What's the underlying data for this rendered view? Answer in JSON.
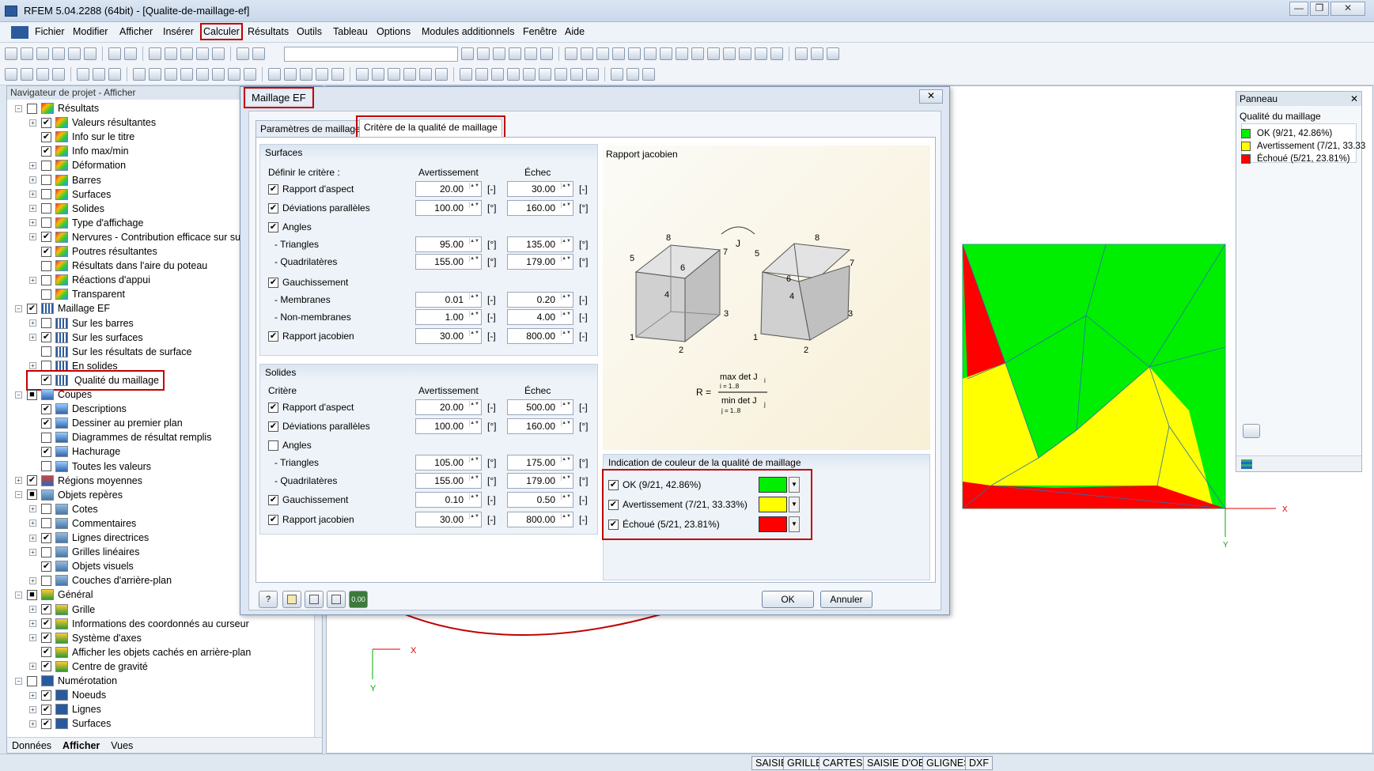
{
  "window": {
    "title": "RFEM 5.04.2288 (64bit) - [Qualite-de-maillage-ef]",
    "minimize": "—",
    "maximize": "❐",
    "close": "✕"
  },
  "menu": [
    "Fichier",
    "Modifier",
    "Afficher",
    "Insérer",
    "Calculer",
    "Résultats",
    "Outils",
    "Tableau",
    "Options",
    "Modules additionnels",
    "Fenêtre",
    "Aide"
  ],
  "navigator": {
    "header": "Navigateur de projet - Afficher",
    "items": [
      {
        "label": "Résultats",
        "level": 0,
        "expander": "−",
        "checked": "",
        "icon": "results-icon"
      },
      {
        "label": "Valeurs résultantes",
        "level": 1,
        "expander": "+",
        "checked": "✔",
        "icon": "results-icon"
      },
      {
        "label": "Info sur le titre",
        "level": 1,
        "expander": "",
        "checked": "✔",
        "icon": "results-icon"
      },
      {
        "label": "Info max/min",
        "level": 1,
        "expander": "",
        "checked": "✔",
        "icon": "results-icon"
      },
      {
        "label": "Déformation",
        "level": 1,
        "expander": "+",
        "checked": "",
        "icon": "results-icon"
      },
      {
        "label": "Barres",
        "level": 1,
        "expander": "+",
        "checked": "",
        "icon": "results-icon"
      },
      {
        "label": "Surfaces",
        "level": 1,
        "expander": "+",
        "checked": "",
        "icon": "results-icon"
      },
      {
        "label": "Solides",
        "level": 1,
        "expander": "+",
        "checked": "",
        "icon": "results-icon"
      },
      {
        "label": "Type d'affichage",
        "level": 1,
        "expander": "+",
        "checked": "",
        "icon": "results-icon"
      },
      {
        "label": "Nervures - Contribution efficace sur surf",
        "level": 1,
        "expander": "+",
        "checked": "✔",
        "icon": "results-icon"
      },
      {
        "label": "Poutres résultantes",
        "level": 1,
        "expander": "",
        "checked": "✔",
        "icon": "results-icon"
      },
      {
        "label": "Résultats dans l'aire du poteau",
        "level": 1,
        "expander": "",
        "checked": "",
        "icon": "results-icon"
      },
      {
        "label": "Réactions d'appui",
        "level": 1,
        "expander": "+",
        "checked": "",
        "icon": "results-icon"
      },
      {
        "label": "Transparent",
        "level": 1,
        "expander": "",
        "checked": "",
        "icon": "results-icon"
      },
      {
        "label": "Maillage EF",
        "level": 0,
        "expander": "−",
        "checked": "✔",
        "icon": "mesh-icon"
      },
      {
        "label": "Sur les barres",
        "level": 1,
        "expander": "+",
        "checked": "",
        "icon": "mesh-icon"
      },
      {
        "label": "Sur les surfaces",
        "level": 1,
        "expander": "+",
        "checked": "✔",
        "icon": "mesh-icon"
      },
      {
        "label": "Sur les résultats de surface",
        "level": 1,
        "expander": "",
        "checked": "",
        "icon": "mesh-icon"
      },
      {
        "label": "En solides",
        "level": 1,
        "expander": "+",
        "checked": "",
        "icon": "mesh-icon"
      },
      {
        "label": "Qualité du maillage",
        "level": 1,
        "expander": "",
        "checked": "✔",
        "icon": "mesh-icon"
      },
      {
        "label": "Coupes",
        "level": 0,
        "expander": "−",
        "checked": "■",
        "icon": "section-icon"
      },
      {
        "label": "Descriptions",
        "level": 1,
        "expander": "",
        "checked": "✔",
        "icon": "section-icon"
      },
      {
        "label": "Dessiner au premier plan",
        "level": 1,
        "expander": "",
        "checked": "✔",
        "icon": "section-icon"
      },
      {
        "label": "Diagrammes de résultat remplis",
        "level": 1,
        "expander": "",
        "checked": "",
        "icon": "section-icon"
      },
      {
        "label": "Hachurage",
        "level": 1,
        "expander": "",
        "checked": "✔",
        "icon": "section-icon"
      },
      {
        "label": "Toutes les valeurs",
        "level": 1,
        "expander": "",
        "checked": "",
        "icon": "section-icon"
      },
      {
        "label": "Régions moyennes",
        "level": 0,
        "expander": "+",
        "checked": "✔",
        "icon": "region-icon"
      },
      {
        "label": "Objets repères",
        "level": 0,
        "expander": "−",
        "checked": "■",
        "icon": "guide-icon"
      },
      {
        "label": "Cotes",
        "level": 1,
        "expander": "+",
        "checked": "",
        "icon": "guide-icon"
      },
      {
        "label": "Commentaires",
        "level": 1,
        "expander": "+",
        "checked": "",
        "icon": "guide-icon"
      },
      {
        "label": "Lignes directrices",
        "level": 1,
        "expander": "+",
        "checked": "✔",
        "icon": "guide-icon"
      },
      {
        "label": "Grilles linéaires",
        "level": 1,
        "expander": "+",
        "checked": "",
        "icon": "guide-icon"
      },
      {
        "label": "Objets visuels",
        "level": 1,
        "expander": "",
        "checked": "✔",
        "icon": "guide-icon"
      },
      {
        "label": "Couches d'arrière-plan",
        "level": 1,
        "expander": "+",
        "checked": "",
        "icon": "guide-icon"
      },
      {
        "label": "Général",
        "level": 0,
        "expander": "−",
        "checked": "■",
        "icon": "general-icon"
      },
      {
        "label": "Grille",
        "level": 1,
        "expander": "+",
        "checked": "✔",
        "icon": "general-icon"
      },
      {
        "label": "Informations des coordonnés au curseur",
        "level": 1,
        "expander": "+",
        "checked": "✔",
        "icon": "general-icon"
      },
      {
        "label": "Système d'axes",
        "level": 1,
        "expander": "+",
        "checked": "✔",
        "icon": "general-icon"
      },
      {
        "label": "Afficher les objets cachés en arrière-plan",
        "level": 1,
        "expander": "",
        "checked": "✔",
        "icon": "general-icon"
      },
      {
        "label": "Centre de gravité",
        "level": 1,
        "expander": "+",
        "checked": "✔",
        "icon": "general-icon"
      },
      {
        "label": "Numérotation",
        "level": 0,
        "expander": "−",
        "checked": "",
        "icon": "number-icon"
      },
      {
        "label": "Noeuds",
        "level": 1,
        "expander": "+",
        "checked": "✔",
        "icon": "number-icon"
      },
      {
        "label": "Lignes",
        "level": 1,
        "expander": "+",
        "checked": "✔",
        "icon": "number-icon"
      },
      {
        "label": "Surfaces",
        "level": 1,
        "expander": "+",
        "checked": "✔",
        "icon": "number-icon"
      }
    ],
    "footer_tabs": [
      "Données",
      "Afficher",
      "Vues"
    ]
  },
  "dialog": {
    "title": "Maillage EF",
    "close": "✕",
    "tabs": [
      "Paramètres de maillage EF",
      "Critère de la qualité de maillage"
    ],
    "surfaces": {
      "title": "Surfaces",
      "define": "Définir le critère :",
      "warn": "Avertissement",
      "fail": "Échec",
      "rows": [
        {
          "label": "Rapport d'aspect",
          "check": "✔",
          "warn": "20.00",
          "wu": "[-]",
          "fail": "30.00",
          "fu": "[-]"
        },
        {
          "label": "Déviations parallèles",
          "check": "✔",
          "warn": "100.00",
          "wu": "[°]",
          "fail": "160.00",
          "fu": "[°]"
        },
        {
          "label": "Angles",
          "check": "✔"
        },
        {
          "label": "- Triangles",
          "warn": "95.00",
          "wu": "[°]",
          "fail": "135.00",
          "fu": "[°]"
        },
        {
          "label": "- Quadrilatères",
          "warn": "155.00",
          "wu": "[°]",
          "fail": "179.00",
          "fu": "[°]"
        },
        {
          "label": "Gauchissement",
          "check": "✔"
        },
        {
          "label": "- Membranes",
          "warn": "0.01",
          "wu": "[-]",
          "fail": "0.20",
          "fu": "[-]"
        },
        {
          "label": "- Non-membranes",
          "warn": "1.00",
          "wu": "[-]",
          "fail": "4.00",
          "fu": "[-]"
        },
        {
          "label": "Rapport jacobien",
          "check": "✔",
          "warn": "30.00",
          "wu": "[-]",
          "fail": "800.00",
          "fu": "[-]"
        }
      ]
    },
    "solids": {
      "title": "Solides",
      "criterion": "Critère",
      "warn": "Avertissement",
      "fail": "Échec",
      "rows": [
        {
          "label": "Rapport d'aspect",
          "check": "✔",
          "warn": "20.00",
          "wu": "[-]",
          "fail": "500.00",
          "fu": "[-]"
        },
        {
          "label": "Déviations parallèles",
          "check": "✔",
          "warn": "100.00",
          "wu": "[°]",
          "fail": "160.00",
          "fu": "[°]"
        },
        {
          "label": "Angles",
          "check": ""
        },
        {
          "label": "- Triangles",
          "warn": "105.00",
          "wu": "[°]",
          "fail": "175.00",
          "fu": "[°]"
        },
        {
          "label": "- Quadrilatères",
          "warn": "155.00",
          "wu": "[°]",
          "fail": "179.00",
          "fu": "[°]"
        },
        {
          "label": "Gauchissement",
          "check": "✔",
          "warn": "0.10",
          "wu": "[-]",
          "fail": "0.50",
          "fu": "[-]"
        },
        {
          "label": "Rapport jacobien",
          "check": "✔",
          "warn": "30.00",
          "wu": "[-]",
          "fail": "800.00",
          "fu": "[-]"
        }
      ]
    },
    "jacobian": {
      "title": "Rapport jacobien",
      "j": "J",
      "r": "R =",
      "num": "max det J",
      "num_sub": "i",
      "num_range": "i = 1..8",
      "den": "min det J",
      "den_sub": "j",
      "den_range": "j = 1..8",
      "nodes_left": [
        "8",
        "7",
        "5",
        "6",
        "4",
        "3",
        "1",
        "2"
      ],
      "nodes_right": [
        "8",
        "7",
        "5",
        "6",
        "4",
        "3",
        "1",
        "2"
      ]
    },
    "colors": {
      "title": "Indication de couleur de la qualité de maillage",
      "items": [
        {
          "label": "OK (9/21, 42.86%)",
          "color": "#00ee00"
        },
        {
          "label": "Avertissement (7/21, 33.33%)",
          "color": "#ffff00"
        },
        {
          "label": "Échoué (5/21, 23.81%)",
          "color": "#ff0000"
        }
      ]
    },
    "buttons": {
      "ok": "OK",
      "cancel": "Annuler",
      "calc": "0.00"
    }
  },
  "panel": {
    "title": "Panneau",
    "close": "✕",
    "subtitle": "Qualité du maillage",
    "legend": [
      {
        "label": "OK (9/21, 42.86%)",
        "color": "#00ee00"
      },
      {
        "label": "Avertissement (7/21, 33.33",
        "color": "#ffff00"
      },
      {
        "label": "Échoué (5/21, 23.81%)",
        "color": "#ff0000"
      }
    ]
  },
  "axes": {
    "x": "X",
    "y": "Y"
  },
  "statusbar": [
    "SAISIE",
    "GRILLE",
    "CARTES",
    "SAISIE D'OB.",
    "GLIGNES",
    "DXF"
  ]
}
